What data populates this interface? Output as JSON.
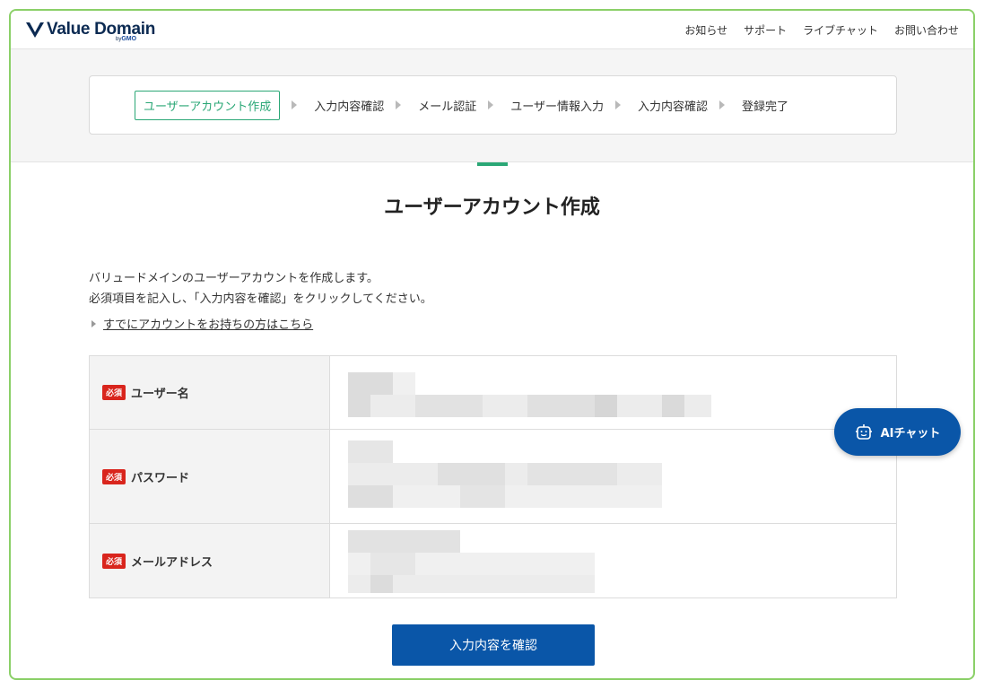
{
  "header": {
    "logo_text": "Value Domain",
    "logo_by": "by",
    "logo_gmo": "GMO",
    "nav": [
      "お知らせ",
      "サポート",
      "ライブチャット",
      "お問い合わせ"
    ]
  },
  "steps": [
    {
      "label": "ユーザーアカウント作成",
      "active": true
    },
    {
      "label": "入力内容確認",
      "active": false
    },
    {
      "label": "メール認証",
      "active": false
    },
    {
      "label": "ユーザー情報入力",
      "active": false
    },
    {
      "label": "入力内容確認",
      "active": false
    },
    {
      "label": "登録完了",
      "active": false
    }
  ],
  "main": {
    "title": "ユーザーアカウント作成",
    "intro_line1": "バリュードメインのユーザーアカウントを作成します。",
    "intro_line2": "必須項目を記入し、「入力内容を確認」をクリックしてください。",
    "login_link": "すでにアカウントをお持ちの方はこちら"
  },
  "form": {
    "required_badge": "必須",
    "fields": [
      {
        "label": "ユーザー名"
      },
      {
        "label": "パスワード"
      },
      {
        "label": "メールアドレス"
      }
    ]
  },
  "confirm_button": "入力内容を確認",
  "ai_chat": {
    "label": "AIチャット"
  },
  "colors": {
    "accent_green": "#2aa776",
    "primary_blue": "#0a56a8",
    "required_red": "#d9251d",
    "frame_green": "#8bd068"
  }
}
